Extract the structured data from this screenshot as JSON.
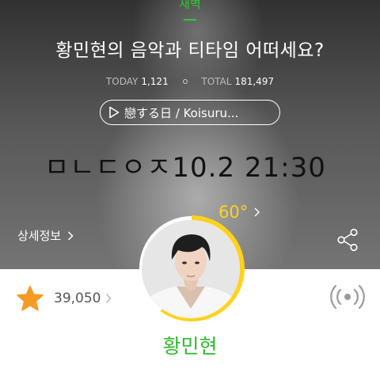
{
  "header": {
    "category": "새벽",
    "title": "황민현의 음악과 티타임 어떠세요?",
    "today_label": "TODAY",
    "today_value": "1,121",
    "total_label": "TOTAL",
    "total_value": "181,497"
  },
  "song": {
    "label": "戀する日 / Koisuru..."
  },
  "banner": {
    "countdown": "ㅁㄴㄷㅇㅈ10.2 21:30"
  },
  "detail": {
    "label": "상세정보"
  },
  "rating": {
    "value": "39,050"
  },
  "temperature": {
    "value": "60",
    "unit": "°",
    "level": 0.6,
    "color": "#ffd21e"
  },
  "profile": {
    "name": "황민현"
  },
  "colors": {
    "accent_green": "#32c832",
    "star_orange": "#f59a23"
  },
  "icons": {
    "play": "play-icon",
    "detail_chevron": "chevron-right-icon",
    "share": "share-icon",
    "star": "star-icon",
    "radio": "broadcast-icon"
  }
}
